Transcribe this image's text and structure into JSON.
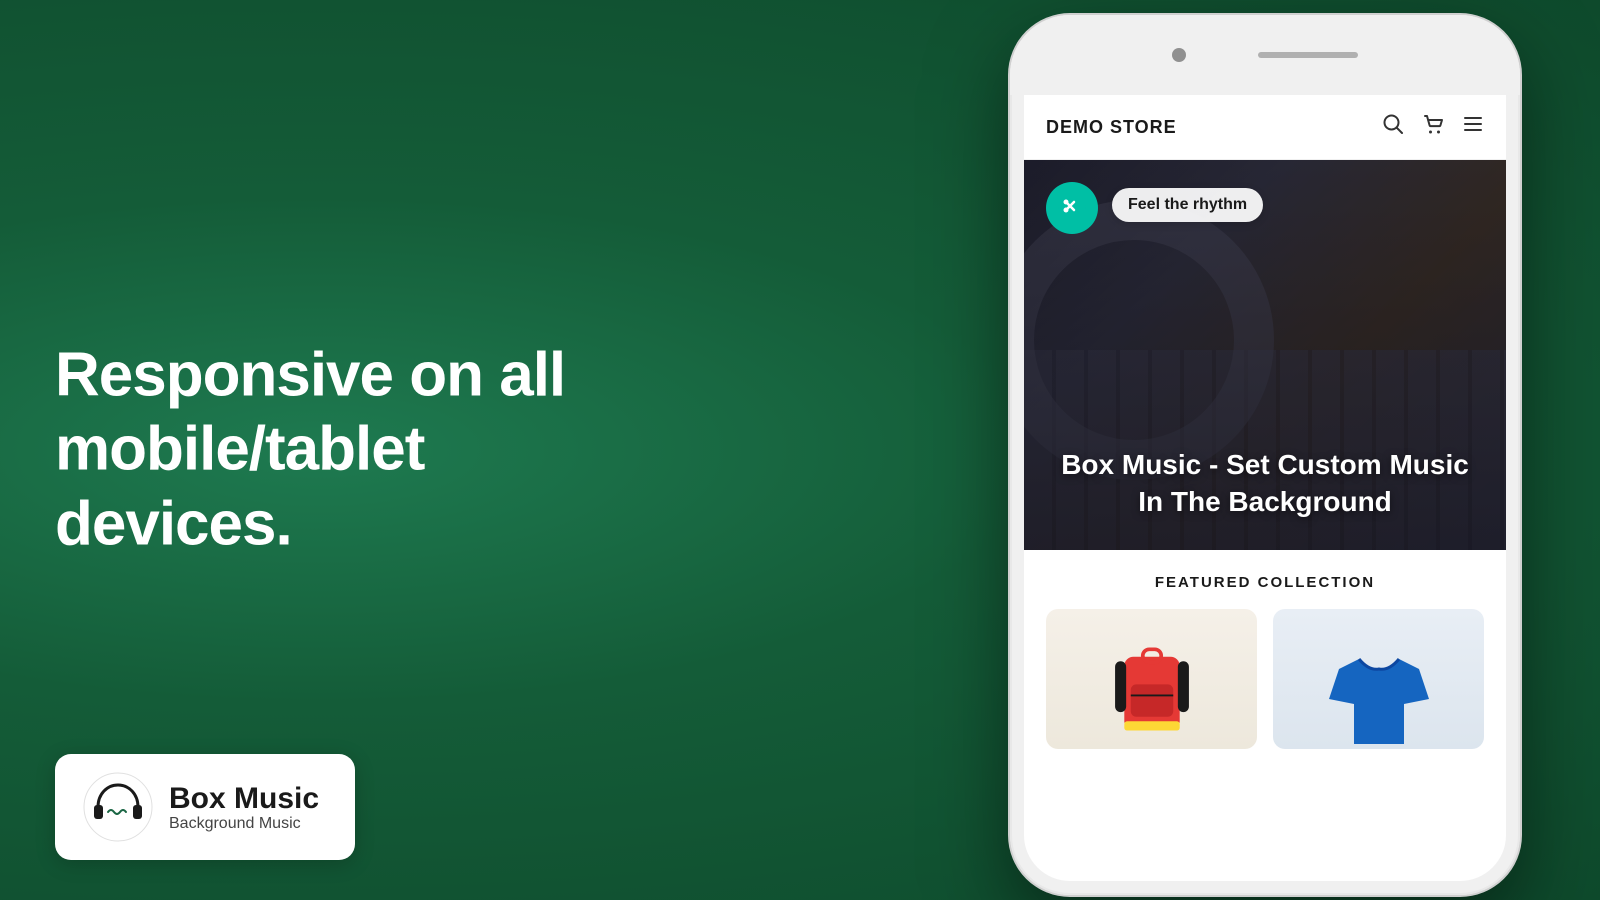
{
  "background": {
    "color": "#1a6644"
  },
  "left": {
    "headline_line1": "Responsive on all mobile/tablet",
    "headline_line2": "devices."
  },
  "brand": {
    "name": "Box Music",
    "tagline": "Background Music"
  },
  "phone": {
    "store_name": "DEMO STORE",
    "hero": {
      "feel_rhythm": "Feel the rhythm",
      "title": "Box Music - Set Custom Music In The Background"
    },
    "featured": {
      "section_title": "FEATURED COLLECTION"
    }
  }
}
